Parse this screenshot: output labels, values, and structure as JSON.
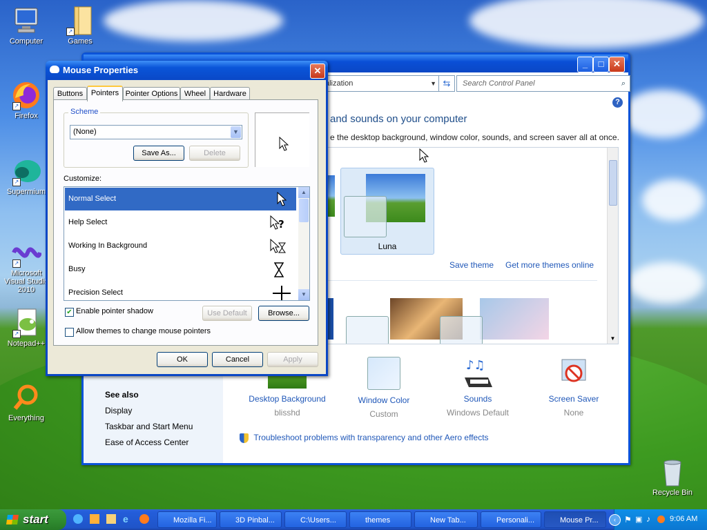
{
  "desktop": {
    "icons": [
      {
        "label": "Computer",
        "icon": "computer-icon"
      },
      {
        "label": "Games",
        "icon": "folder-icon"
      },
      {
        "label": "Firefox",
        "icon": "firefox-icon"
      },
      {
        "label": "Supermium",
        "icon": "supermium-icon"
      },
      {
        "label": "Microsoft Visual Studio 2010",
        "icon": "visual-studio-icon"
      },
      {
        "label": "Notepad++",
        "icon": "notepad-plus-icon"
      },
      {
        "label": "Everything",
        "icon": "everything-search-icon"
      },
      {
        "label": "Recycle Bin",
        "icon": "recycle-bin-icon"
      }
    ]
  },
  "control_panel": {
    "address": "alization",
    "search_placeholder": "Search Control Panel",
    "heading": "and sounds on your computer",
    "subheading": "e the desktop background, window color, sounds, and screen saver all at once.",
    "theme_name": "Luna",
    "save_theme": "Save theme",
    "get_more_themes": "Get more themes online",
    "categories": [
      {
        "label": "Desktop Background",
        "value": "blisshd"
      },
      {
        "label": "Window Color",
        "value": "Custom"
      },
      {
        "label": "Sounds",
        "value": "Windows Default"
      },
      {
        "label": "Screen Saver",
        "value": "None"
      }
    ],
    "troubleshoot": "Troubleshoot problems with transparency and other Aero effects",
    "see_also": {
      "title": "See also",
      "links": [
        "Display",
        "Taskbar and Start Menu",
        "Ease of Access Center"
      ]
    }
  },
  "dialog": {
    "title": "Mouse Properties",
    "tabs": [
      "Buttons",
      "Pointers",
      "Pointer Options",
      "Wheel",
      "Hardware"
    ],
    "scheme_label": "Scheme",
    "scheme_value": "(None)",
    "save_as": "Save As...",
    "delete": "Delete",
    "customize_label": "Customize:",
    "pointers": [
      {
        "name": "Normal Select",
        "glyph": "arrow"
      },
      {
        "name": "Help Select",
        "glyph": "help"
      },
      {
        "name": "Working In Background",
        "glyph": "working"
      },
      {
        "name": "Busy",
        "glyph": "hourglass"
      },
      {
        "name": "Precision Select",
        "glyph": "cross"
      }
    ],
    "enable_shadow": "Enable pointer shadow",
    "use_default": "Use Default",
    "browse": "Browse...",
    "allow_themes": "Allow themes to change mouse pointers",
    "ok": "OK",
    "cancel": "Cancel",
    "apply": "Apply"
  },
  "taskbar": {
    "start": "start",
    "tasks": [
      "Mozilla Fi...",
      "3D Pinbal...",
      "C:\\Users...",
      "themes",
      "New Tab...",
      "Personali...",
      "Mouse Pr..."
    ],
    "clock": "9:06 AM"
  }
}
